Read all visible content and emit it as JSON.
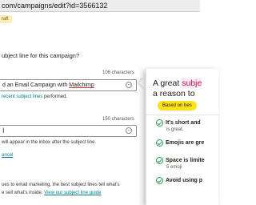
{
  "browser": {
    "url": "com/campaigns/edit?id=3566132"
  },
  "campaign": {
    "status_badge": "raft"
  },
  "subject": {
    "question": "ubject line for this campaign?",
    "char_count": "106 characters",
    "value_prefix": "d an Email Campaign with ",
    "value_brand": "Mailchimp",
    "recent_link": "recent subject lines",
    "recent_suffix": " performed."
  },
  "preview": {
    "char_count": "150 characters",
    "value": "I",
    "helper": "will appear in the inbox after the subject line."
  },
  "actions": {
    "cancel": "ancel"
  },
  "footer": {
    "line1": "ues to email marketing, the best subject lines tell what's",
    "line2_prefix": "e sell what's inside. ",
    "line2_link": "View our subject line guide"
  },
  "panel": {
    "title_line1_a": "A great ",
    "title_line1_b": "subje",
    "title_line2": "a reason to",
    "badge": "Based on bes",
    "tips": [
      {
        "label": "It's short and",
        "sub": "is great."
      },
      {
        "label": "Emojis are gre",
        "sub": ""
      },
      {
        "label": "Space is limite",
        "sub": "5 emoji"
      },
      {
        "label": "Avoid using p",
        "sub": ""
      }
    ]
  },
  "colors": {
    "accent_link": "#007c89",
    "badge_yellow": "#ffe01b",
    "check_green": "#2a9d5c",
    "highlight_pink": "#c2185b"
  }
}
